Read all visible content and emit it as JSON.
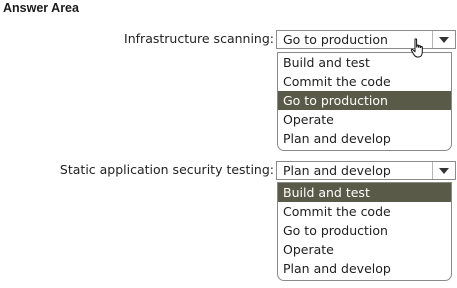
{
  "answer_area": {
    "title": "Answer Area"
  },
  "rows": [
    {
      "label": "Infrastructure scanning:",
      "selected_value": "Go to production",
      "options": [
        "Build and test",
        "Commit the code",
        "Go to production",
        "Operate",
        "Plan and develop"
      ],
      "highlighted_index": 2
    },
    {
      "label": "Static application security testing:",
      "selected_value": "Plan and develop",
      "options": [
        "Build and test",
        "Commit the code",
        "Go to production",
        "Operate",
        "Plan and develop"
      ],
      "highlighted_index": 0
    }
  ],
  "icons": {
    "dropdown": "chevron-down-icon",
    "cursor": "hand-pointer-icon"
  },
  "colors": {
    "highlight": "#5a5a48",
    "highlight_text": "#ffffff",
    "border": "#8c8c8c"
  }
}
